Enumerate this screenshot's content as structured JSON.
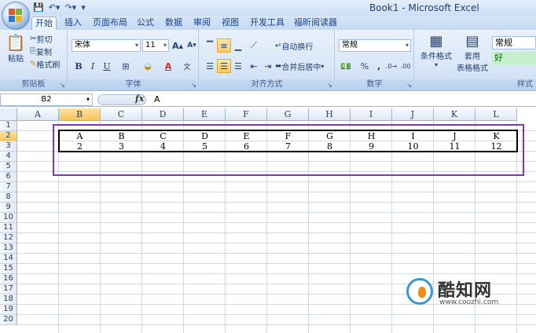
{
  "app": {
    "window_title": "Book1 - Microsoft Excel"
  },
  "tabs": [
    {
      "label": "开始",
      "active": true
    },
    {
      "label": "插入"
    },
    {
      "label": "页面布局"
    },
    {
      "label": "公式"
    },
    {
      "label": "数据"
    },
    {
      "label": "审阅"
    },
    {
      "label": "视图"
    },
    {
      "label": "开发工具"
    },
    {
      "label": "福昕阅读器"
    }
  ],
  "ribbon": {
    "clipboard": {
      "label": "剪贴板",
      "paste": "粘贴",
      "cut": "剪切",
      "copy": "复制",
      "format_painter": "格式刷"
    },
    "font": {
      "label": "字体",
      "font_name": "宋体",
      "font_size": "11"
    },
    "alignment": {
      "label": "对齐方式",
      "wrap_text": "自动换行",
      "merge_center": "合并后居中"
    },
    "number": {
      "label": "数字",
      "format": "常规",
      "percent": "%"
    },
    "styles": {
      "label": "样式",
      "conditional_formatting": "条件格式",
      "format_as_table": "套用",
      "format_as_table_2": "表格格式",
      "style_normal": "常规",
      "style_good": "好"
    }
  },
  "formula_bar": {
    "name_box": "B2",
    "fx": "fx",
    "content": "A"
  },
  "sheet": {
    "columns": [
      "A",
      "B",
      "C",
      "D",
      "E",
      "F",
      "G",
      "H",
      "I",
      "J",
      "K",
      "L"
    ],
    "rows": [
      "1",
      "2",
      "3",
      "4",
      "5",
      "6",
      "7",
      "8",
      "9",
      "10",
      "11",
      "12",
      "13",
      "14",
      "15",
      "16",
      "17",
      "18",
      "19",
      "20"
    ],
    "selected_column": "B",
    "selected_row": "2",
    "row2": [
      "A",
      "B",
      "C",
      "D",
      "E",
      "F",
      "G",
      "H",
      "I",
      "J",
      "K"
    ],
    "row3": [
      "2",
      "3",
      "4",
      "5",
      "6",
      "7",
      "8",
      "9",
      "10",
      "11",
      "12"
    ]
  },
  "watermark": {
    "brand": "酷知网",
    "url": "www.coozhi.com"
  },
  "colors": {
    "highlight_box": "#7e3aa5",
    "selected_header": "#f7c45d"
  }
}
